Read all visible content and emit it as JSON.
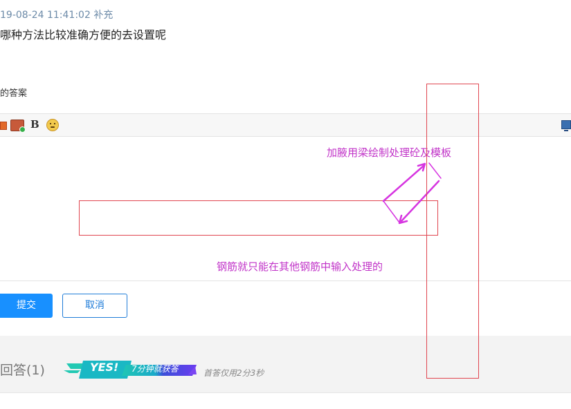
{
  "question": {
    "timestamp": "19-08-24 11:41:02 补充",
    "text": "哪种方法比较准确方便的去设置呢"
  },
  "answer_label": "的答案",
  "editor": {
    "toolbar": {
      "bold_label": "B",
      "icons": [
        "image-icon",
        "insert-picture-icon",
        "bold-icon",
        "emoji-icon",
        "monitor-icon"
      ]
    },
    "annotations": {
      "top": "加腋用梁绘制处理砼及模板",
      "bottom": "钢筋就只能在其他钢筋中输入处理的"
    }
  },
  "actions": {
    "submit_label": "提交",
    "cancel_label": "取消"
  },
  "answers_section": {
    "count_label": "回答(1)",
    "badge_yes": "YES!",
    "badge_number": "7",
    "badge_text": "7分钟就获答",
    "first_answer_note": "首答仅用2分3秒"
  },
  "colors": {
    "accent": "#1890ff",
    "annotation": "#c133c8",
    "highlight_box": "#e0454f",
    "timestamp": "#6c8aa8"
  }
}
